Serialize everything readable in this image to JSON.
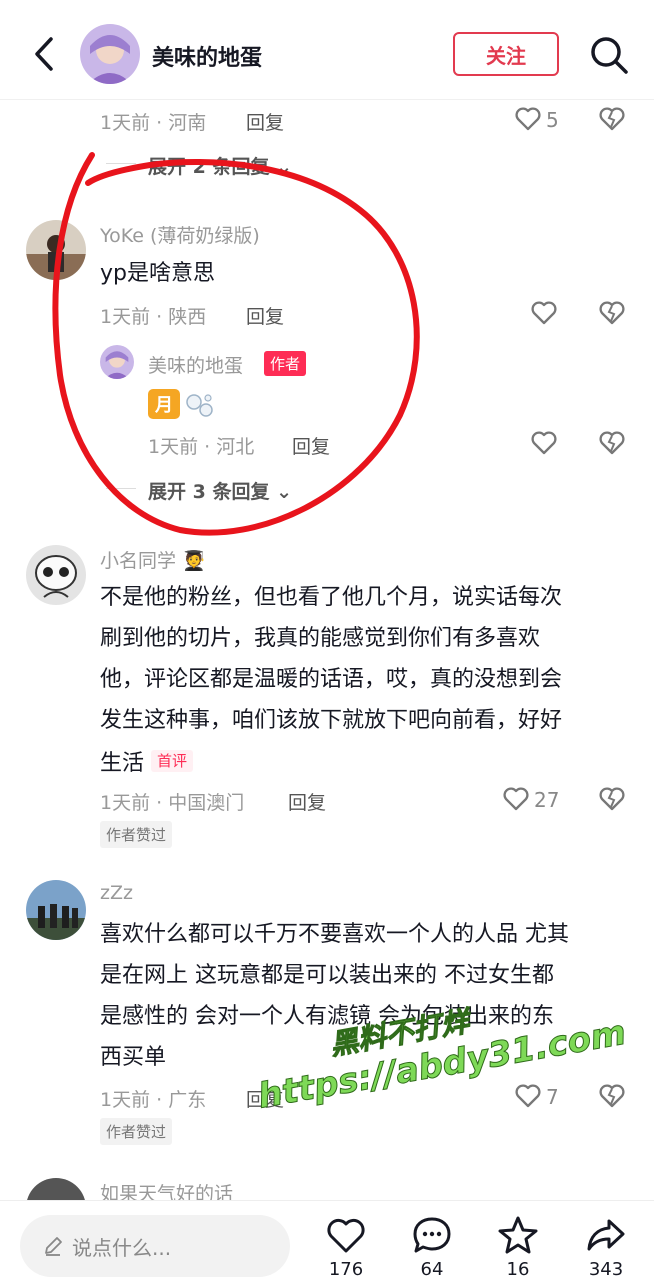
{
  "header": {
    "author_name": "美味的地蛋",
    "follow_label": "关注"
  },
  "top_comment": {
    "meta": "1天前 · 河南",
    "reply_label": "回复",
    "likes": "5",
    "expand": "展开 2 条回复"
  },
  "comment_yoke": {
    "name": "YoKe (薄荷奶绿版)",
    "text": "yp是啥意思",
    "meta": "1天前 · 陕西",
    "reply_label": "回复",
    "sub_reply": {
      "name": "美味的地蛋",
      "author_tag": "作者",
      "emoji_text": "月",
      "meta": "1天前 · 河北",
      "reply_label": "回复"
    },
    "expand": "展开 3 条回复"
  },
  "comment_xiaoming": {
    "name": "小名同学 🧑‍🎓",
    "lines": [
      "不是他的粉丝，但也看了他几个月，说实话每次",
      "刷到他的切片，我真的能感觉到你们有多喜欢",
      "他，评论区都是温暖的话语，哎，真的没想到会",
      "发生这种事，咱们该放下就放下吧向前看，好好"
    ],
    "last_line": "生活",
    "first_tag": "首评",
    "meta": "1天前 · 中国澳门",
    "reply_label": "回复",
    "likes": "27",
    "liked_tag": "作者赞过"
  },
  "comment_zzz": {
    "name": "zZz",
    "lines": [
      "喜欢什么都可以千万不要喜欢一个人的人品 尤其",
      "是在网上 这玩意都是可以装出来的 不过女生都",
      "是感性的 会对一个人有滤镜 会为包装出来的东",
      "西买单"
    ],
    "meta": "1天前 · 广东",
    "reply_label": "回复",
    "likes": "7",
    "liked_tag": "作者赞过"
  },
  "comment_next": {
    "name": "如果天气好的话"
  },
  "watermark": {
    "line1": "黑料不打烊",
    "line2": "https://abdy31.com"
  },
  "bottom_bar": {
    "input_placeholder": "说点什么...",
    "likes": "176",
    "comments": "64",
    "favorites": "16",
    "shares": "343"
  },
  "colors": {
    "accent": "#fe2c55",
    "follow": "#e23a4f",
    "annotation": "#e8141c",
    "watermark": "#7ed957"
  }
}
